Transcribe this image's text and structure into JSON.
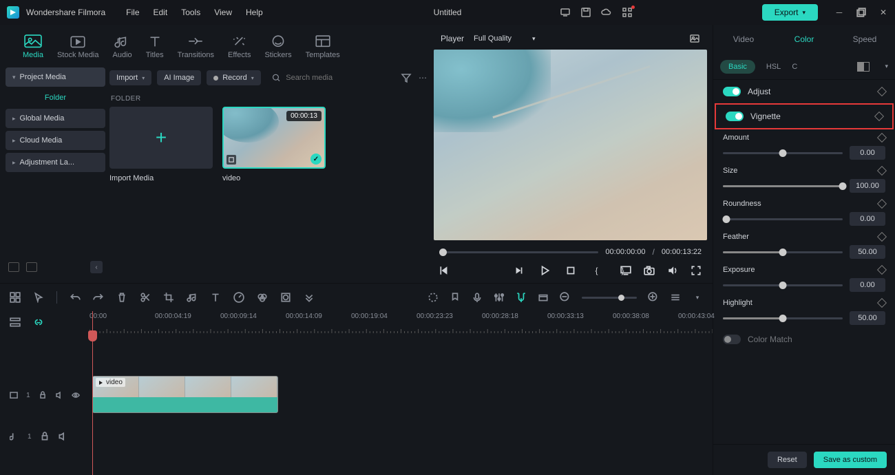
{
  "app": {
    "brand": "Wondershare Filmora",
    "title": "Untitled"
  },
  "menus": [
    "File",
    "Edit",
    "Tools",
    "View",
    "Help"
  ],
  "export_label": "Export",
  "media_tabs": [
    {
      "id": "media",
      "label": "Media"
    },
    {
      "id": "stock",
      "label": "Stock Media"
    },
    {
      "id": "audio",
      "label": "Audio"
    },
    {
      "id": "titles",
      "label": "Titles"
    },
    {
      "id": "transitions",
      "label": "Transitions"
    },
    {
      "id": "effects",
      "label": "Effects"
    },
    {
      "id": "stickers",
      "label": "Stickers"
    },
    {
      "id": "templates",
      "label": "Templates"
    }
  ],
  "sidebar": {
    "project_media": "Project Media",
    "folder": "Folder",
    "items": [
      "Global Media",
      "Cloud Media",
      "Adjustment La..."
    ]
  },
  "media_toolbar": {
    "import": "Import",
    "ai_image": "AI Image",
    "record": "Record",
    "search_placeholder": "Search media"
  },
  "folder_header": "FOLDER",
  "clips": {
    "import_label": "Import Media",
    "video": {
      "label": "video",
      "duration": "00:00:13"
    }
  },
  "player": {
    "label": "Player",
    "quality": "Full Quality",
    "current": "00:00:00:00",
    "total": "00:00:13:22"
  },
  "inspector": {
    "tabs": [
      "Video",
      "Color",
      "Speed"
    ],
    "subtabs": {
      "basic": "Basic",
      "hsl": "HSL",
      "c": "C"
    },
    "adjust": "Adjust",
    "vignette": "Vignette",
    "sliders": [
      {
        "key": "amount",
        "label": "Amount",
        "value": "0.00",
        "pos": 50,
        "fill": 0
      },
      {
        "key": "size",
        "label": "Size",
        "value": "100.00",
        "pos": 100,
        "fill": 100
      },
      {
        "key": "roundness",
        "label": "Roundness",
        "value": "0.00",
        "pos": 3,
        "fill": 0
      },
      {
        "key": "feather",
        "label": "Feather",
        "value": "50.00",
        "pos": 50,
        "fill": 50
      },
      {
        "key": "exposure",
        "label": "Exposure",
        "value": "0.00",
        "pos": 50,
        "fill": 0
      },
      {
        "key": "highlight",
        "label": "Highlight",
        "value": "50.00",
        "pos": 50,
        "fill": 50
      }
    ],
    "color_match": "Color Match",
    "reset": "Reset",
    "save": "Save as custom"
  },
  "timeline": {
    "ruler": [
      "00:00",
      "00:00:04:19",
      "00:00:09:14",
      "00:00:14:09",
      "00:00:19:04",
      "00:00:23:23",
      "00:00:28:18",
      "00:00:33:13",
      "00:00:38:08",
      "00:00:43:04"
    ],
    "clip_label": "video",
    "video_track": "1",
    "audio_track": "1"
  }
}
